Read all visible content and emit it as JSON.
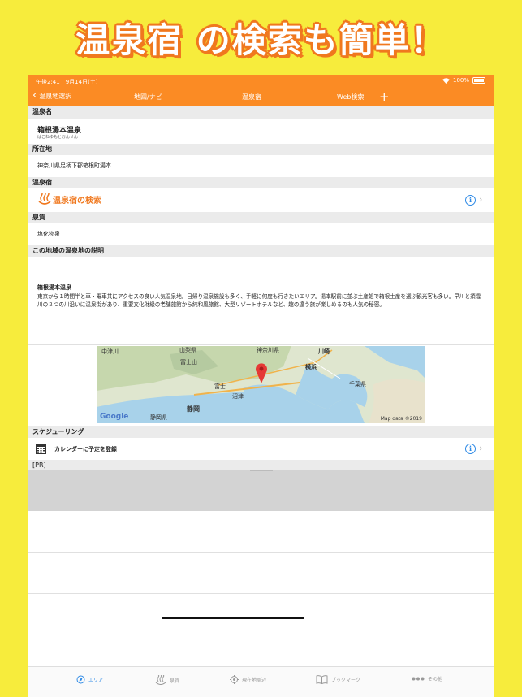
{
  "banner": {
    "title": "温泉宿 の検索も簡単！"
  },
  "status": {
    "time_date": "午後2:41　9月14日(土)",
    "battery": "100%"
  },
  "nav": {
    "back": "温泉地選択",
    "map": "地図/ナビ",
    "inn": "温泉宿",
    "web": "Web検索",
    "add": "+"
  },
  "sections": {
    "name": "温泉名",
    "location": "所在地",
    "inn": "温泉宿",
    "quality": "泉質",
    "description": "この地域の温泉地の説明",
    "schedule": "スケジューリング",
    "pr": "[PR]"
  },
  "onsen": {
    "name": "箱根湯本温泉",
    "reading": "はこねゆもとおんせん",
    "address": "神奈川県足柄下郡箱根町湯本",
    "inn_search": "温泉宿の検索",
    "quality": "塩化物泉",
    "desc_title": "箱根湯本温泉",
    "desc_body": "東京から１時間半と車・電車共にアクセスの良い人気温泉地。日帰り温泉施設も多く、手軽に何度も行きたいエリア。湯本駅前に並ぶ土産処で箱根土産を選ぶ観光客も多い。早川と須雲川の２つの川沿いに温泉街があり、重要文化財級の老舗旅館から純和風旅館、大型リゾートホテルなど、趣の違う旅が楽しめるのも人気の秘密。"
  },
  "map": {
    "labels": [
      "中津川",
      "山梨県",
      "富士山",
      "神奈川県",
      "川崎",
      "横浜",
      "千葉県",
      "富士",
      "沼津",
      "静岡",
      "静岡県"
    ],
    "google": "Google",
    "copyright": "Map data ©2019"
  },
  "schedule": {
    "calendar": "カレンダーに予定を登録"
  },
  "tabs": [
    "エリア",
    "泉質",
    "現在地周辺",
    "ブックマーク",
    "その他"
  ],
  "colors": {
    "accent": "#fb8b24",
    "banner_bg": "#f7ec3c",
    "link_blue": "#2e8ae6"
  }
}
